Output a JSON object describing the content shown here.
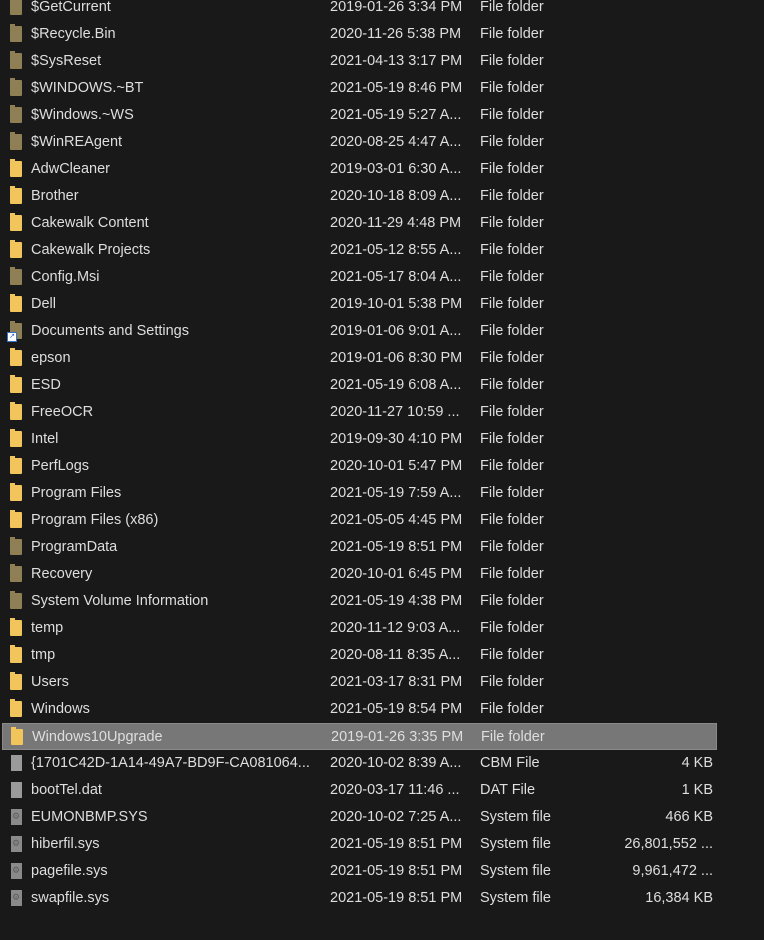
{
  "rows": [
    {
      "name": "$GetCurrent",
      "date": "2019-01-26 3:34 PM",
      "type": "File folder",
      "size": "",
      "icon": "folder-hidden-icon"
    },
    {
      "name": "$Recycle.Bin",
      "date": "2020-11-26 5:38 PM",
      "type": "File folder",
      "size": "",
      "icon": "folder-hidden-icon"
    },
    {
      "name": "$SysReset",
      "date": "2021-04-13 3:17 PM",
      "type": "File folder",
      "size": "",
      "icon": "folder-hidden-icon"
    },
    {
      "name": "$WINDOWS.~BT",
      "date": "2021-05-19 8:46 PM",
      "type": "File folder",
      "size": "",
      "icon": "folder-hidden-icon"
    },
    {
      "name": "$Windows.~WS",
      "date": "2021-05-19 5:27 A...",
      "type": "File folder",
      "size": "",
      "icon": "folder-hidden-icon"
    },
    {
      "name": "$WinREAgent",
      "date": "2020-08-25 4:47 A...",
      "type": "File folder",
      "size": "",
      "icon": "folder-hidden-icon"
    },
    {
      "name": "AdwCleaner",
      "date": "2019-03-01 6:30 A...",
      "type": "File folder",
      "size": "",
      "icon": "folder-icon"
    },
    {
      "name": "Brother",
      "date": "2020-10-18 8:09 A...",
      "type": "File folder",
      "size": "",
      "icon": "folder-icon"
    },
    {
      "name": "Cakewalk Content",
      "date": "2020-11-29 4:48 PM",
      "type": "File folder",
      "size": "",
      "icon": "folder-icon"
    },
    {
      "name": "Cakewalk Projects",
      "date": "2021-05-12 8:55 A...",
      "type": "File folder",
      "size": "",
      "icon": "folder-icon"
    },
    {
      "name": "Config.Msi",
      "date": "2021-05-17 8:04 A...",
      "type": "File folder",
      "size": "",
      "icon": "folder-hidden-icon"
    },
    {
      "name": "Dell",
      "date": "2019-10-01 5:38 PM",
      "type": "File folder",
      "size": "",
      "icon": "folder-icon"
    },
    {
      "name": "Documents and Settings",
      "date": "2019-01-06 9:01 A...",
      "type": "File folder",
      "size": "",
      "icon": "folder-shortcut-icon"
    },
    {
      "name": "epson",
      "date": "2019-01-06 8:30 PM",
      "type": "File folder",
      "size": "",
      "icon": "folder-icon"
    },
    {
      "name": "ESD",
      "date": "2021-05-19 6:08 A...",
      "type": "File folder",
      "size": "",
      "icon": "folder-icon"
    },
    {
      "name": "FreeOCR",
      "date": "2020-11-27 10:59 ...",
      "type": "File folder",
      "size": "",
      "icon": "folder-icon"
    },
    {
      "name": "Intel",
      "date": "2019-09-30 4:10 PM",
      "type": "File folder",
      "size": "",
      "icon": "folder-icon"
    },
    {
      "name": "PerfLogs",
      "date": "2020-10-01 5:47 PM",
      "type": "File folder",
      "size": "",
      "icon": "folder-icon"
    },
    {
      "name": "Program Files",
      "date": "2021-05-19 7:59 A...",
      "type": "File folder",
      "size": "",
      "icon": "folder-icon"
    },
    {
      "name": "Program Files (x86)",
      "date": "2021-05-05 4:45 PM",
      "type": "File folder",
      "size": "",
      "icon": "folder-icon"
    },
    {
      "name": "ProgramData",
      "date": "2021-05-19 8:51 PM",
      "type": "File folder",
      "size": "",
      "icon": "folder-hidden-icon"
    },
    {
      "name": "Recovery",
      "date": "2020-10-01 6:45 PM",
      "type": "File folder",
      "size": "",
      "icon": "folder-hidden-icon"
    },
    {
      "name": "System Volume Information",
      "date": "2021-05-19 4:38 PM",
      "type": "File folder",
      "size": "",
      "icon": "folder-hidden-icon"
    },
    {
      "name": "temp",
      "date": "2020-11-12 9:03 A...",
      "type": "File folder",
      "size": "",
      "icon": "folder-icon"
    },
    {
      "name": "tmp",
      "date": "2020-08-11 8:35 A...",
      "type": "File folder",
      "size": "",
      "icon": "folder-icon"
    },
    {
      "name": "Users",
      "date": "2021-03-17 8:31 PM",
      "type": "File folder",
      "size": "",
      "icon": "folder-icon"
    },
    {
      "name": "Windows",
      "date": "2021-05-19 8:54 PM",
      "type": "File folder",
      "size": "",
      "icon": "folder-icon"
    },
    {
      "name": "Windows10Upgrade",
      "date": "2019-01-26 3:35 PM",
      "type": "File folder",
      "size": "",
      "icon": "folder-icon",
      "selected": true
    },
    {
      "name": "{1701C42D-1A14-49A7-BD9F-CA081064...",
      "date": "2020-10-02 8:39 A...",
      "type": "CBM File",
      "size": "4 KB",
      "icon": "file-icon"
    },
    {
      "name": "bootTel.dat",
      "date": "2020-03-17 11:46 ...",
      "type": "DAT File",
      "size": "1 KB",
      "icon": "file-icon"
    },
    {
      "name": "EUMONBMP.SYS",
      "date": "2020-10-02 7:25 A...",
      "type": "System file",
      "size": "466 KB",
      "icon": "system-file-icon"
    },
    {
      "name": "hiberfil.sys",
      "date": "2021-05-19 8:51 PM",
      "type": "System file",
      "size": "26,801,552 ...",
      "icon": "system-file-icon"
    },
    {
      "name": "pagefile.sys",
      "date": "2021-05-19 8:51 PM",
      "type": "System file",
      "size": "9,961,472 ...",
      "icon": "system-file-icon"
    },
    {
      "name": "swapfile.sys",
      "date": "2021-05-19 8:51 PM",
      "type": "System file",
      "size": "16,384 KB",
      "icon": "system-file-icon"
    }
  ],
  "colors": {
    "background": "#191919",
    "text": "#dedede",
    "selection": "#777777",
    "folder": "#f2c55c",
    "folder_hidden": "#8f7f55"
  }
}
